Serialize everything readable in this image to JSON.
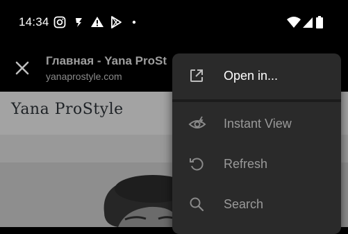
{
  "status_bar": {
    "time": "14:34",
    "left_icons": [
      "instagram-icon",
      "flash-icon",
      "warning-icon",
      "play-store-icon",
      "dot-icon"
    ],
    "right_icons": [
      "wifi-icon",
      "signal-icon",
      "battery-icon"
    ]
  },
  "browser_bar": {
    "title": "Главная - Yana ProSt",
    "url": "yanaprostyle.com"
  },
  "webpage": {
    "logo_text": "Yana ProStyle"
  },
  "overflow_menu": {
    "items": [
      {
        "label": "Open in...",
        "icon": "open-external-icon"
      },
      {
        "label": "Instant View",
        "icon": "instant-view-icon"
      },
      {
        "label": "Refresh",
        "icon": "refresh-icon"
      },
      {
        "label": "Search",
        "icon": "search-icon"
      }
    ]
  },
  "colors": {
    "background": "#000000",
    "menu": "#2a2a2a",
    "page_bg": "#a6a6a6"
  }
}
